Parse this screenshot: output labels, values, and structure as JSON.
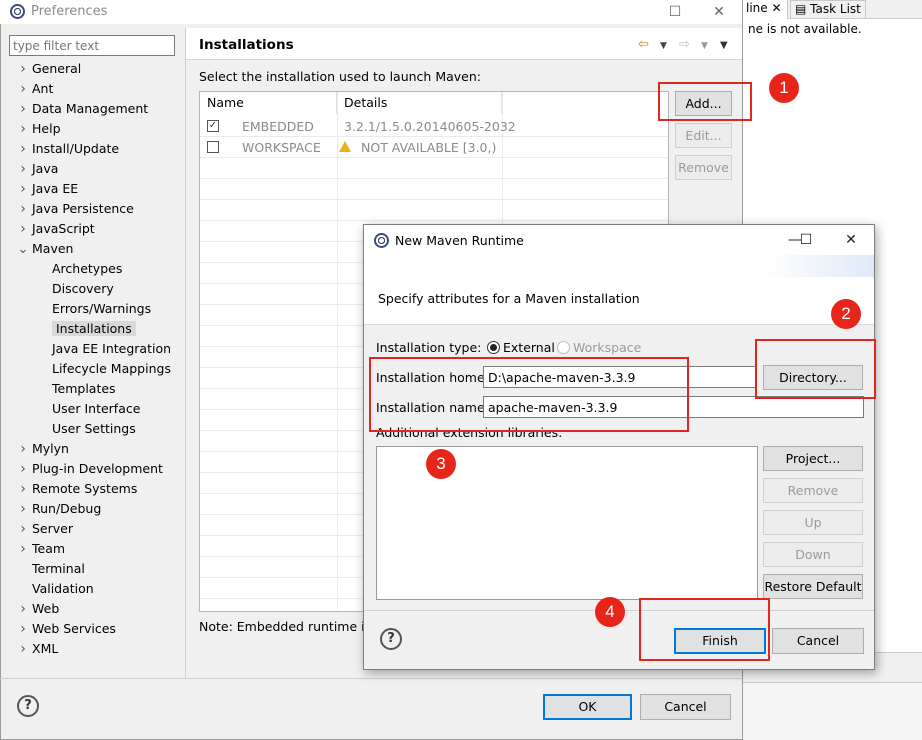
{
  "background": {
    "tabs": [
      "line",
      "Task List"
    ],
    "message": "ne is not available."
  },
  "preferences": {
    "title": "Preferences",
    "filter_placeholder": "type filter text",
    "tree": [
      {
        "label": "General",
        "expandable": true
      },
      {
        "label": "Ant",
        "expandable": true
      },
      {
        "label": "Data Management",
        "expandable": true
      },
      {
        "label": "Help",
        "expandable": true
      },
      {
        "label": "Install/Update",
        "expandable": true
      },
      {
        "label": "Java",
        "expandable": true
      },
      {
        "label": "Java EE",
        "expandable": true
      },
      {
        "label": "Java Persistence",
        "expandable": true
      },
      {
        "label": "JavaScript",
        "expandable": true
      },
      {
        "label": "Maven",
        "expanded": true
      }
    ],
    "maven_children": [
      "Archetypes",
      "Discovery",
      "Errors/Warnings",
      "Installations",
      "Java EE Integration",
      "Lifecycle Mappings",
      "Templates",
      "User Interface",
      "User Settings"
    ],
    "selected_child": "Installations",
    "tree_after": [
      {
        "label": "Mylyn",
        "expandable": true
      },
      {
        "label": "Plug-in Development",
        "expandable": true
      },
      {
        "label": "Remote Systems",
        "expandable": true
      },
      {
        "label": "Run/Debug",
        "expandable": true
      },
      {
        "label": "Server",
        "expandable": true
      },
      {
        "label": "Team",
        "expandable": true
      },
      {
        "label": "Terminal",
        "expandable": false
      },
      {
        "label": "Validation",
        "expandable": false
      },
      {
        "label": "Web",
        "expandable": true
      },
      {
        "label": "Web Services",
        "expandable": true
      },
      {
        "label": "XML",
        "expandable": true
      }
    ],
    "page_title": "Installations",
    "select_label": "Select the installation used to launch Maven:",
    "columns": [
      "Name",
      "Details"
    ],
    "rows": [
      {
        "checked": true,
        "name": "EMBEDDED",
        "details": "3.2.1/1.5.0.20140605-2032",
        "warning": false
      },
      {
        "checked": false,
        "name": "WORKSPACE",
        "details": "NOT AVAILABLE [3.0,)",
        "warning": true
      }
    ],
    "buttons": {
      "add": "Add...",
      "edit": "Edit...",
      "remove": "Remove"
    },
    "note": "Note: Embedded runtime is",
    "ok": "OK",
    "cancel": "Cancel",
    "help": "?"
  },
  "dialog": {
    "title": "New Maven Runtime",
    "description": "Specify attributes for a Maven installation",
    "installation_type_label": "Installation type:",
    "type_external": "External",
    "type_workspace": "Workspace",
    "home_label": "Installation home:",
    "home_value": "D:\\apache-maven-3.3.9",
    "name_label": "Installation name:",
    "name_value": "apache-maven-3.3.9",
    "directory_button": "Directory...",
    "ext_label": "Additional extension libraries:",
    "buttons": {
      "project": "Project...",
      "remove": "Remove",
      "up": "Up",
      "down": "Down",
      "restore": "Restore Default"
    },
    "finish": "Finish",
    "cancel": "Cancel",
    "help": "?"
  },
  "annotations": [
    "1",
    "2",
    "3",
    "4"
  ],
  "annotation_color": "#e3261c"
}
